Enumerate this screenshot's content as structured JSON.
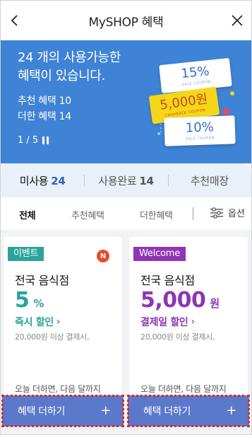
{
  "header": {
    "title": "MySHOP 혜택",
    "back_icon": "chevron-left-icon",
    "close_icon": "close-icon"
  },
  "banner": {
    "headline_line1": "24 개의 사용가능한",
    "headline_line2": "혜택이 있습니다.",
    "recommend": "추천 혜택 10",
    "plus": "더한 혜택 14",
    "pager": "1 / 5",
    "background_color": "#3f83d6",
    "coupons": [
      {
        "value": "15%",
        "caption": "SALE COUPON"
      },
      {
        "value": "5,000원",
        "caption": "CASHBACK COUPON"
      },
      {
        "value": "10%",
        "caption": "SALE COUPON"
      }
    ]
  },
  "tabs": [
    {
      "label": "미사용",
      "count": "24"
    },
    {
      "label": "사용완료",
      "count": "14"
    },
    {
      "label": "추천매장",
      "count": ""
    }
  ],
  "filters": {
    "all": "전체",
    "recommended": "추천혜택",
    "added": "더한혜택",
    "options": "옵션"
  },
  "cards": [
    {
      "badge": "이벤트",
      "new": "N",
      "store": "전국 음식점",
      "amount": "5",
      "unit": "%",
      "discount": "즉시 할인",
      "condition": "20,000원 이상 결제시,",
      "note": "오늘 더하면, 다음 달까지",
      "button": "혜택 더하기",
      "accent": "#2aa39a"
    },
    {
      "badge": "Welcome",
      "store": "전국 음식점",
      "amount": "5,000",
      "unit": "원",
      "discount": "결제일 할인",
      "condition": "20,000원 이상 결제시,",
      "note": "오늘 더하면, 다음 달까지",
      "button": "혜택 더하기",
      "accent": "#8f35b5"
    }
  ],
  "button_color": "#5a79cb"
}
